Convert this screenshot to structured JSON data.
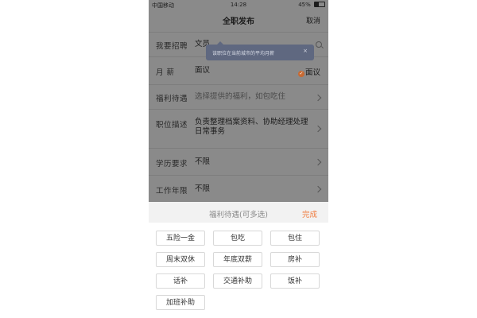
{
  "status_bar": {
    "carrier": "中国移动",
    "time": "14:28",
    "battery": "45%"
  },
  "nav": {
    "title": "全职发布",
    "cancel_label": "取消"
  },
  "form": {
    "position": {
      "label": "我要招聘",
      "value": "文员"
    },
    "salary": {
      "label": "月    薪",
      "value": "面议",
      "checkbox_label": "面议"
    },
    "benefits": {
      "label": "福利待遇",
      "placeholder": "选择提供的福利，如包吃住"
    },
    "description": {
      "label": "职位描述",
      "value": "负责整理档案资料、协助经理处理日常事务"
    },
    "education": {
      "label": "学历要求",
      "value": "不限"
    },
    "experience": {
      "label": "工作年限",
      "value": "不限"
    }
  },
  "tooltip": {
    "text": "该职位在当前城市的平均月薪",
    "close": "×"
  },
  "sheet": {
    "title": "福利待遇(可多选)",
    "done_label": "完成",
    "options": [
      "五险一金",
      "包吃",
      "包住",
      "周末双休",
      "年底双薪",
      "房补",
      "话补",
      "交通补助",
      "饭补",
      "加班补助"
    ]
  },
  "colors": {
    "accent": "#f07a3c",
    "overlay": "#8a8a8a",
    "tooltip_bg": "#5f6880"
  }
}
